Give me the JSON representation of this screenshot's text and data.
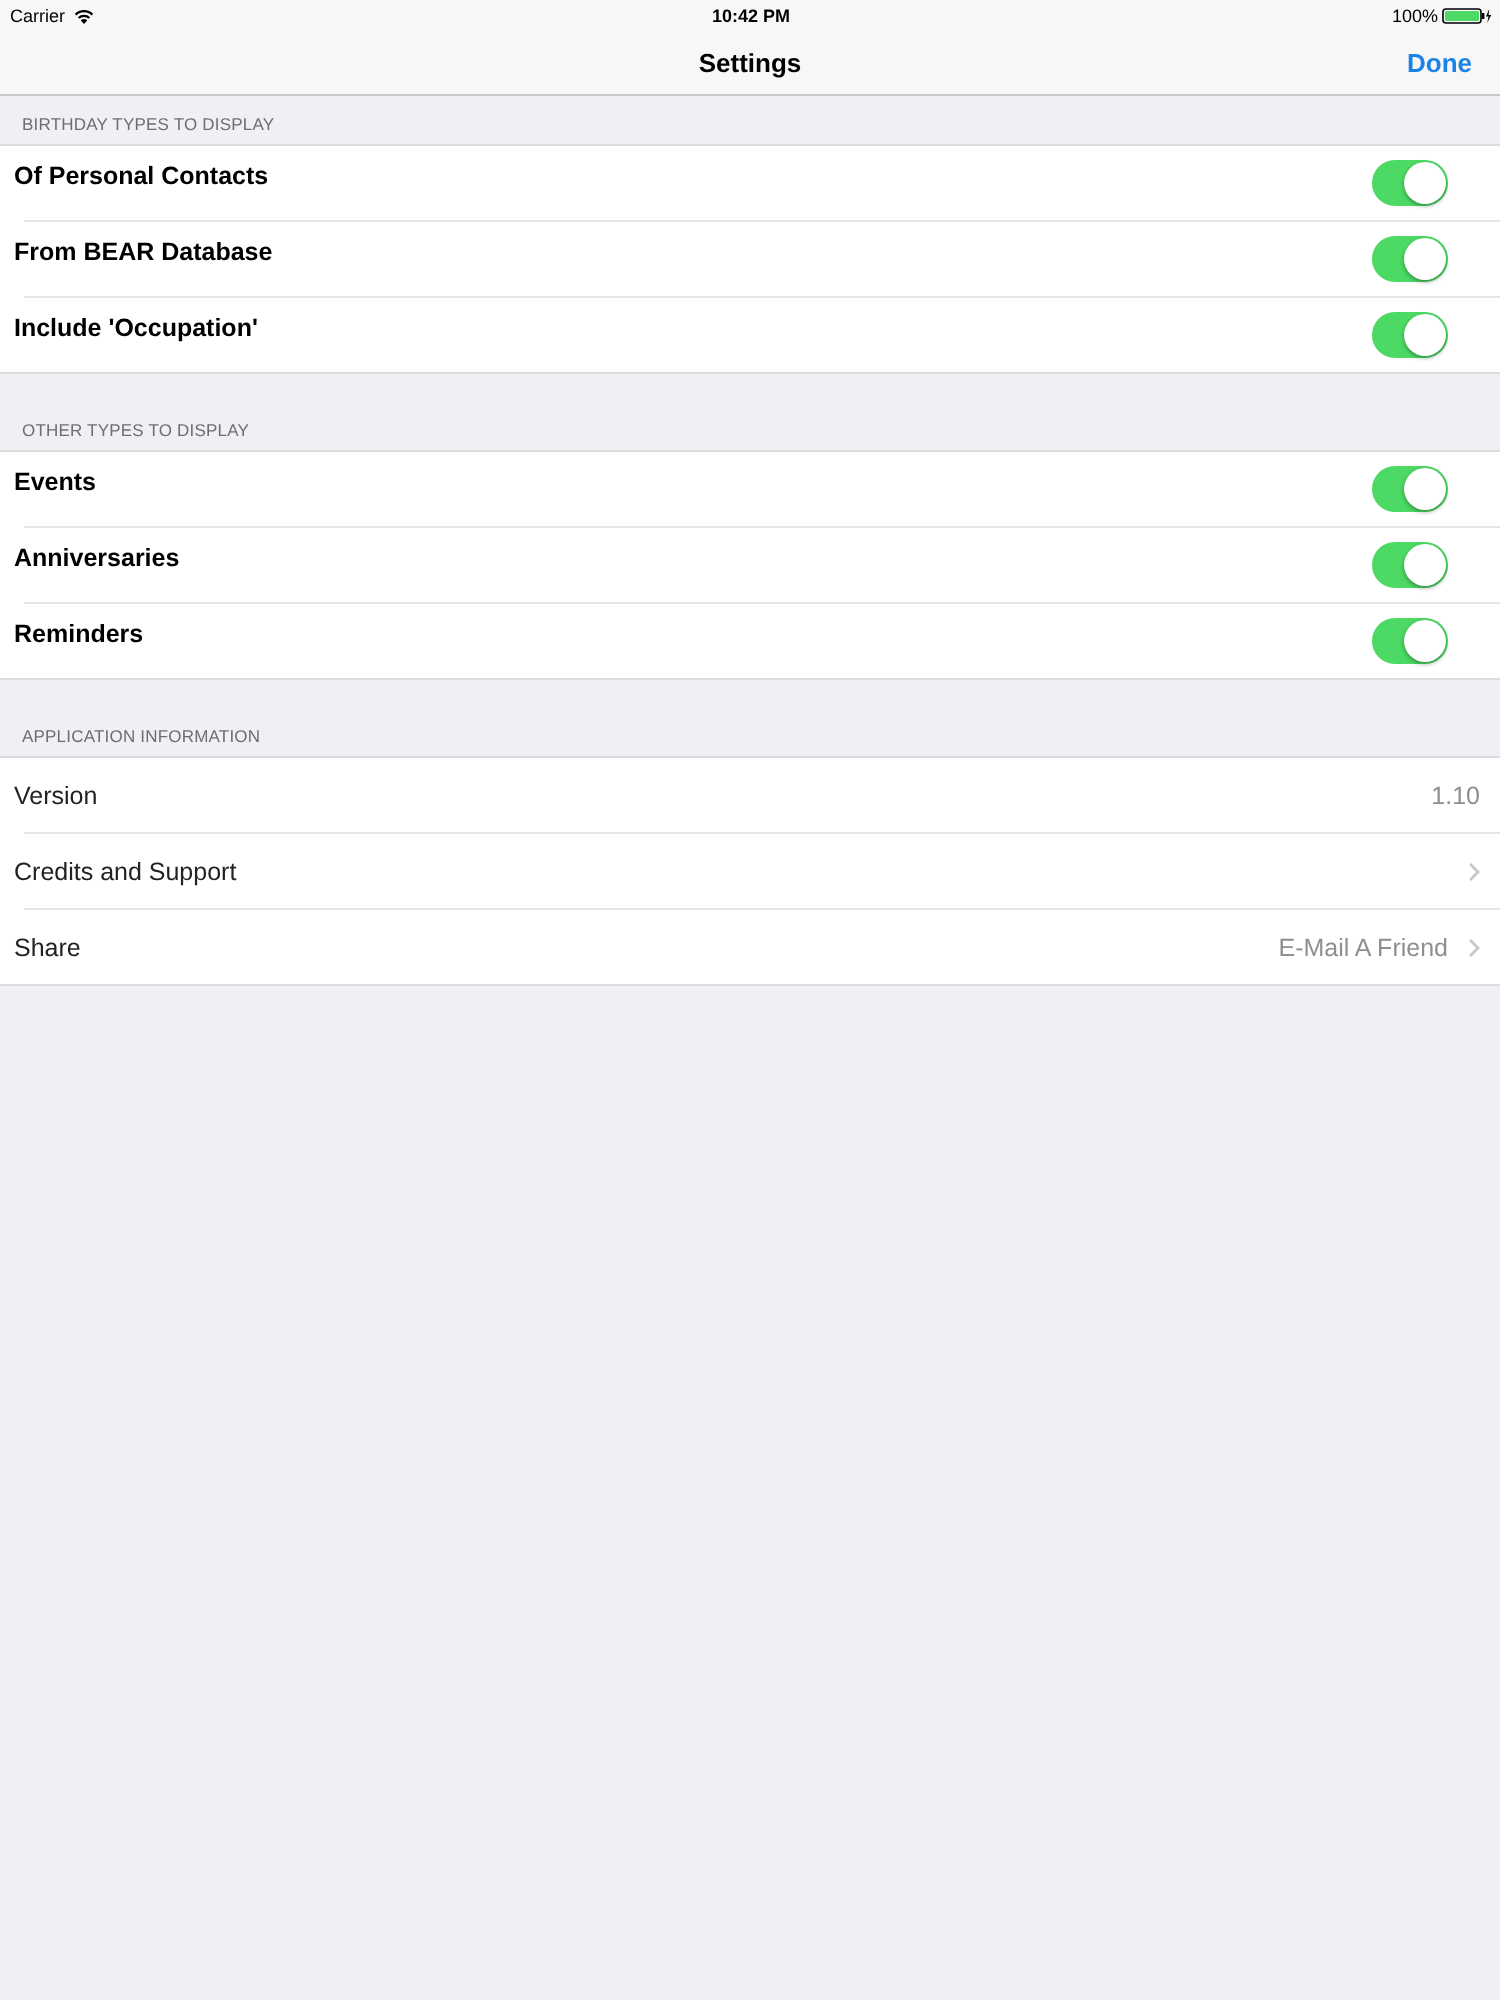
{
  "status_bar": {
    "carrier": "Carrier",
    "time": "10:42 PM",
    "battery": "100%"
  },
  "nav_bar": {
    "title": "Settings",
    "done": "Done"
  },
  "sections": [
    {
      "header": "BIRTHDAY TYPES TO DISPLAY",
      "rows": [
        {
          "kind": "switch",
          "label": "Of Personal Contacts",
          "on": true
        },
        {
          "kind": "switch",
          "label": "From BEAR Database",
          "on": true
        },
        {
          "kind": "switch",
          "label": "Include 'Occupation'",
          "on": true
        }
      ]
    },
    {
      "header": "OTHER TYPES TO DISPLAY",
      "rows": [
        {
          "kind": "switch",
          "label": "Events",
          "on": true
        },
        {
          "kind": "switch",
          "label": "Anniversaries",
          "on": true
        },
        {
          "kind": "switch",
          "label": "Reminders",
          "on": true
        }
      ]
    },
    {
      "header": "APPLICATION INFORMATION",
      "rows": [
        {
          "kind": "detail",
          "label": "Version",
          "value": "1.10",
          "disclosure": false
        },
        {
          "kind": "detail",
          "label": "Credits and Support",
          "disclosure": true
        },
        {
          "kind": "detail",
          "label": "Share",
          "value": "E-Mail A Friend",
          "disclosure": true
        }
      ]
    }
  ]
}
